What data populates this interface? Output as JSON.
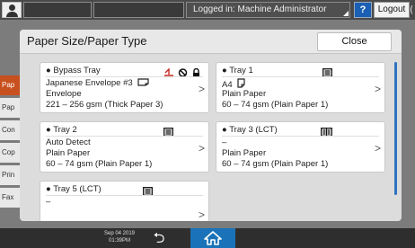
{
  "topbar": {
    "logged_in": "Logged in: Machine Administrator",
    "help_label": "?",
    "logout_label": "Logout"
  },
  "background": {
    "tabs": [
      "Pap",
      "Pap",
      "Con",
      "Cop",
      "Prin",
      "Fax"
    ]
  },
  "dialog": {
    "title": "Paper Size/Paper Type",
    "close_label": "Close"
  },
  "trays": [
    {
      "name": "● Bypass Tray",
      "size": "Japanese Envelope #3",
      "type": "Envelope",
      "weight": "221 – 256 gsm (Thick Paper 3)",
      "icons": [
        "bypass-feed-icon",
        "prohibited-icon",
        "lock-icon"
      ],
      "orientation": "landscape"
    },
    {
      "name": "● Tray 1",
      "size": "A4",
      "type": "Plain Paper",
      "weight": "60 – 74 gsm (Plain Paper 1)",
      "icons": [
        "tray-paper-stack-icon"
      ],
      "orientation": "portrait"
    },
    {
      "name": "● Tray 2",
      "size": "Auto Detect",
      "type": "Plain Paper",
      "weight": "60 – 74 gsm (Plain Paper 1)",
      "icons": [
        "tray-paper-stack-icon"
      ],
      "orientation": ""
    },
    {
      "name": "● Tray 3 (LCT)",
      "size": "–",
      "type": "Plain Paper",
      "weight": "60 – 74 gsm (Plain Paper 1)",
      "icons": [
        "lct-tray-icon"
      ],
      "orientation": ""
    },
    {
      "name": "● Tray 5 (LCT)",
      "size": "–",
      "type": "",
      "weight": "",
      "icons": [
        "tray-paper-stack-icon"
      ],
      "orientation": ""
    }
  ],
  "bottombar": {
    "date": "Sep 04 2019",
    "time": "01:39PM"
  },
  "colors": {
    "accent_blue": "#2f74c0",
    "home_blue": "#1a73b8",
    "active_tab_orange": "#c8501e",
    "bypass_red": "#c8281e"
  }
}
